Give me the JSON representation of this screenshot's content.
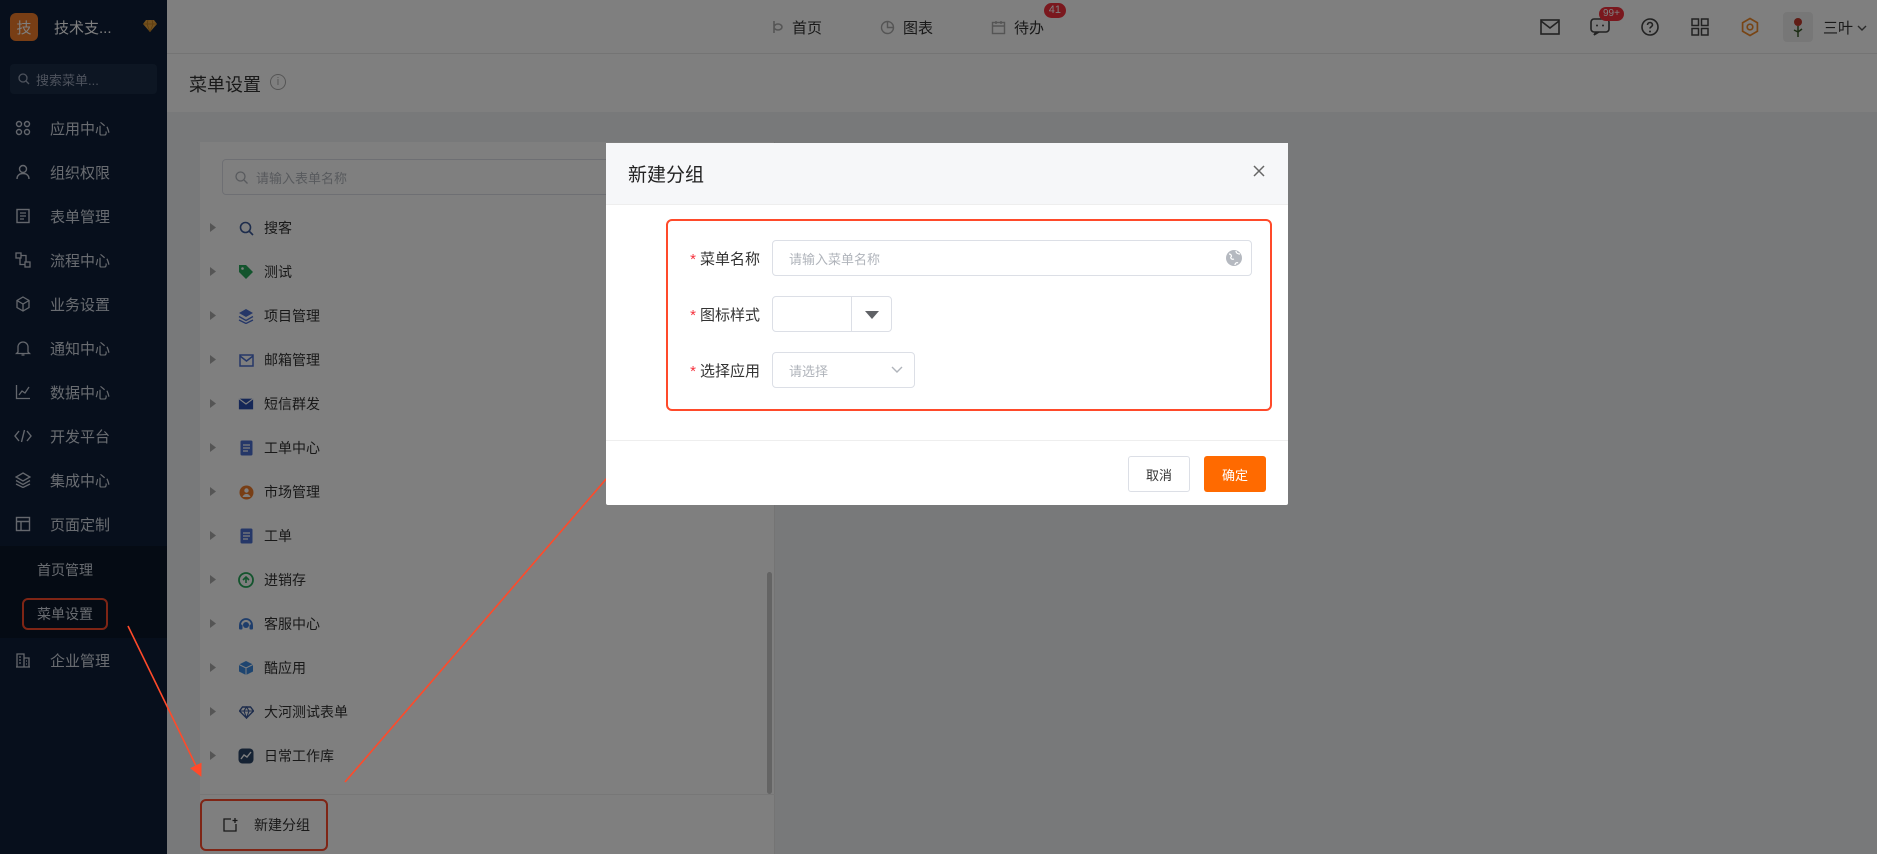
{
  "brand": {
    "logo": "技",
    "name": "技术支...",
    "gem_icon": "diamond-icon"
  },
  "sidebar": {
    "search_placeholder": "搜索菜单...",
    "items": [
      {
        "label": "应用中心",
        "icon": "apps-icon"
      },
      {
        "label": "组织权限",
        "icon": "user-icon"
      },
      {
        "label": "表单管理",
        "icon": "form-icon"
      },
      {
        "label": "流程中心",
        "icon": "flow-icon"
      },
      {
        "label": "业务设置",
        "icon": "box-icon"
      },
      {
        "label": "通知中心",
        "icon": "bell-icon"
      },
      {
        "label": "数据中心",
        "icon": "chart-icon"
      },
      {
        "label": "开发平台",
        "icon": "code-icon"
      },
      {
        "label": "集成中心",
        "icon": "layers-icon"
      },
      {
        "label": "页面定制",
        "icon": "layout-icon"
      }
    ],
    "sub_items": [
      {
        "label": "首页管理"
      },
      {
        "label": "菜单设置"
      }
    ],
    "last_item": {
      "label": "企业管理",
      "icon": "building-icon"
    }
  },
  "topbar": {
    "tabs": [
      {
        "label": "首页",
        "icon": "home-icon"
      },
      {
        "label": "图表",
        "icon": "pie-icon"
      },
      {
        "label": "待办",
        "icon": "calendar-icon",
        "badge": "41"
      }
    ],
    "chat_badge": "99+",
    "username": "三叶"
  },
  "page": {
    "title": "菜单设置",
    "info_icon": "i"
  },
  "tree": {
    "search_placeholder": "请输入表单名称",
    "items": [
      {
        "label": "搜客",
        "icon": "search-icon",
        "color": "#3b5998"
      },
      {
        "label": "测试",
        "icon": "tag-icon",
        "color": "#27a85a"
      },
      {
        "label": "项目管理",
        "icon": "layers-icon",
        "color": "#4a6fd1"
      },
      {
        "label": "邮箱管理",
        "icon": "mail-icon",
        "color": "#4a6fd1"
      },
      {
        "label": "短信群发",
        "icon": "envelope-icon",
        "color": "#2a4fae"
      },
      {
        "label": "工单中心",
        "icon": "doc-icon",
        "color": "#4a6fd1"
      },
      {
        "label": "市场管理",
        "icon": "person-icon",
        "color": "#f07c2a"
      },
      {
        "label": "工单",
        "icon": "doc-icon",
        "color": "#4a6fd1"
      },
      {
        "label": "进销存",
        "icon": "cycle-icon",
        "color": "#27a85a"
      },
      {
        "label": "客服中心",
        "icon": "headset-icon",
        "color": "#3c7bd6"
      },
      {
        "label": "酷应用",
        "icon": "cube-icon",
        "color": "#3c8be0"
      },
      {
        "label": "大河测试表单",
        "icon": "diamond-icon",
        "color": "#3b5998"
      },
      {
        "label": "日常工作库",
        "icon": "chart-box-icon",
        "color": "#2a4466"
      }
    ],
    "new_group_label": "新建分组"
  },
  "modal": {
    "title": "新建分组",
    "fields": [
      {
        "label": "菜单名称",
        "required": "*",
        "placeholder": "请输入菜单名称"
      },
      {
        "label": "图标样式",
        "required": "*"
      },
      {
        "label": "选择应用",
        "required": "*",
        "placeholder": "请选择"
      }
    ],
    "cancel_label": "取消",
    "ok_label": "确定"
  }
}
